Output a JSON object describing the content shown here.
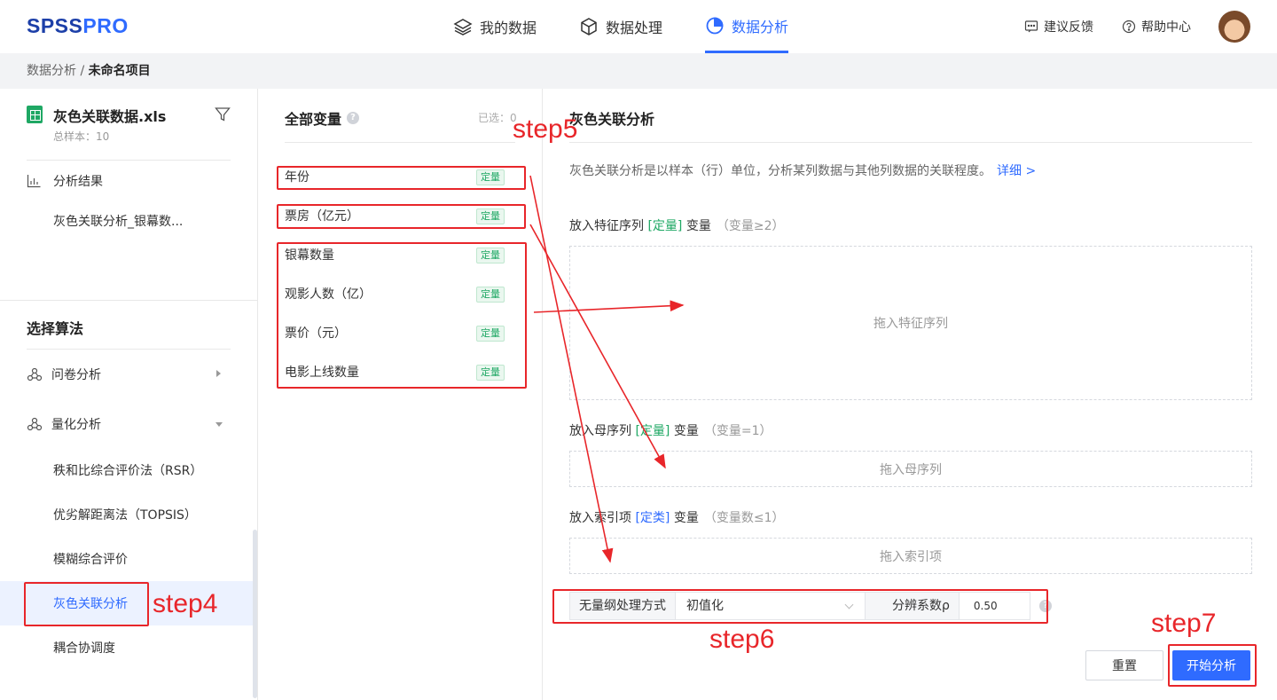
{
  "logo": {
    "part1": "SPSS",
    "part2": "PRO"
  },
  "nav": {
    "my_data": "我的数据",
    "data_processing": "数据处理",
    "data_analysis": "数据分析"
  },
  "tools": {
    "feedback": "建议反馈",
    "help": "帮助中心"
  },
  "breadcrumb": {
    "root": "数据分析 / ",
    "current": "未命名项目"
  },
  "sidebar": {
    "file_name": "灰色关联数据.xls",
    "total_samples": "总样本：10",
    "results_title": "分析结果",
    "result_item": "灰色关联分析_银幕数...",
    "algo_title": "选择算法",
    "groups": [
      "问卷分析",
      "量化分析"
    ],
    "methods": [
      "秩和比综合评价法（RSR）",
      "优劣解距离法（TOPSIS）",
      "模糊综合评价",
      "灰色关联分析",
      "耦合协调度"
    ]
  },
  "variables": {
    "title": "全部变量",
    "selected": "已选：0",
    "tag": "定量",
    "items": [
      "年份",
      "票房（亿元）",
      "银幕数量",
      "观影人数（亿）",
      "票价（元）",
      "电影上线数量"
    ]
  },
  "config": {
    "title": "灰色关联分析",
    "description": "灰色关联分析是以样本（行）单位，分析某列数据与其他列数据的关联程度。",
    "detail_link": "详细 >",
    "feature": {
      "prefix": "放入特征序列 ",
      "type": "[定量]",
      "suffix": " 变量",
      "hint": "（变量≥2）",
      "drop": "拖入特征序列"
    },
    "parent": {
      "prefix": "放入母序列 ",
      "type": "[定量]",
      "suffix": " 变量",
      "hint": "（变量=1）",
      "drop": "拖入母序列"
    },
    "index": {
      "prefix": "放入索引项 ",
      "type": "[定类]",
      "suffix": " 变量",
      "hint": "（变量数≤1）",
      "drop": "拖入索引项"
    },
    "dimensionless_label": "无量纲处理方式",
    "dimensionless_value": "初值化",
    "rho_label": "分辨系数ρ",
    "rho_value": "0.50",
    "reset": "重置",
    "start": "开始分析"
  },
  "annotations": {
    "step4": "step4",
    "step5": "step5",
    "step6": "step6",
    "step7": "step7"
  },
  "colors": {
    "accent": "#2f6bff",
    "annotation": "#e8262a",
    "tag_green": "#1fa864"
  }
}
